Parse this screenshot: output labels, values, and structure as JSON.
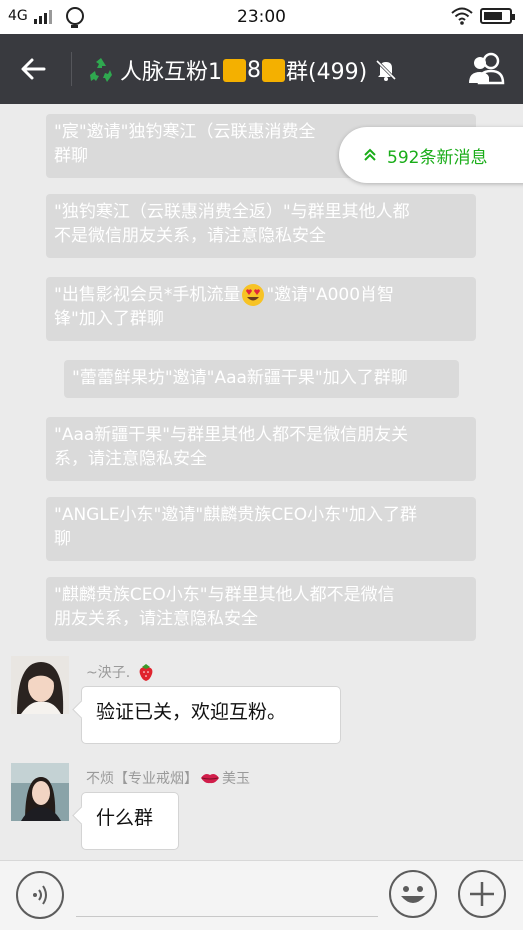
{
  "status_bar": {
    "network": "4G",
    "time": "23:00"
  },
  "header": {
    "title_part1": "人脉互粉1",
    "title_part2": "8",
    "title_part3": "群(499)"
  },
  "new_messages_pill": {
    "label": "592条新消息"
  },
  "notices": [
    {
      "line1": "\"宸\"邀请\"独钓寒江（云联惠消费全",
      "line2": "群聊"
    },
    {
      "line1": "\"独钓寒江（云联惠消费全返）\"与群里其他人都",
      "line2": "不是微信朋友关系，请注意隐私安全"
    },
    {
      "line1a": "\"出售影视会员*手机流量",
      "line1b": "\"邀请\"A000肖智",
      "line2": "锋\"加入了群聊"
    },
    {
      "line1": "\"蕾蕾鲜果坊\"邀请\"Aaa新疆干果\"加入了群聊"
    },
    {
      "line1": "\"Aaa新疆干果\"与群里其他人都不是微信朋友关",
      "line2": "系，请注意隐私安全"
    },
    {
      "line1": "\"ANGLE小东\"邀请\"麒麟贵族CEO小东\"加入了群",
      "line2": "聊"
    },
    {
      "line1": "\"麒麟贵族CEO小东\"与群里其他人都不是微信",
      "line2": "朋友关系，请注意隐私安全"
    }
  ],
  "messages": [
    {
      "sender": "~泱子.",
      "text": "验证已关，欢迎互粉。"
    },
    {
      "sender_a": "不烦【专业戒烟】",
      "sender_b": "美玉",
      "text": "什么群"
    }
  ],
  "input": {
    "placeholder": ""
  },
  "icons": {
    "back": "back-arrow-icon",
    "mute": "bell-muted-icon",
    "members": "group-members-icon",
    "voice": "voice-icon",
    "emoji": "emoji-icon",
    "more": "plus-icon"
  },
  "colors": {
    "title_bar": "#393a3f",
    "accent_green": "#1aad19",
    "notice_bg": "#dadada",
    "yellow_block": "#f4b000"
  }
}
